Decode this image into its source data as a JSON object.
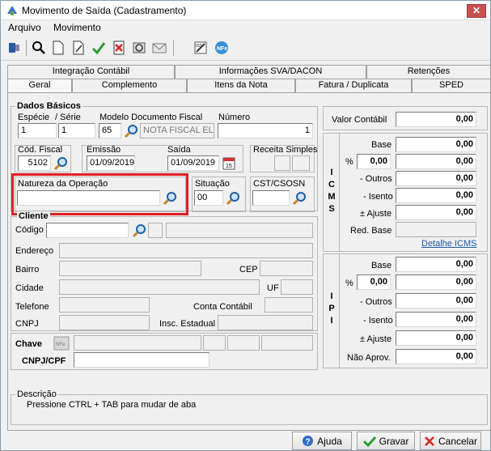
{
  "window": {
    "title": "Movimento de Saída (Cadastramento)",
    "close": "✕"
  },
  "menu": [
    "Arquivo",
    "Movimento"
  ],
  "tabs_top": [
    "Integração Contábil",
    "Informações SVA/DACON",
    "Retenções"
  ],
  "tabs_bottom": [
    "Geral",
    "Complemento",
    "Itens da Nota",
    "Fatura / Duplicata",
    "SPED"
  ],
  "dados": {
    "title": "Dados Básicos",
    "especie_label": "Espécie",
    "serie_label": "/  Série",
    "especie": "1",
    "serie": "1",
    "modelo_label": "Modelo Documento Fiscal",
    "modelo": "65",
    "modelo_desc": "NOTA FISCAL EL",
    "numero_label": "Número",
    "numero": "1",
    "cod_fiscal_label": "Cód. Fiscal",
    "cod_fiscal": "5102",
    "emissao_label": "Emissão",
    "emissao": "01/09/2019",
    "saida_label": "Saída",
    "saida": "01/09/2019",
    "receita_label": "Receita Simples",
    "natureza_label": "Natureza da Operação",
    "natureza": "",
    "situacao_label": "Situação",
    "situacao": "00",
    "cst_label": "CST/CSOSN",
    "cst": ""
  },
  "cliente": {
    "title": "Cliente",
    "codigo_label": "Código",
    "endereco_label": "Endereço",
    "bairro_label": "Bairro",
    "cep_label": "CEP",
    "cidade_label": "Cidade",
    "uf_label": "UF",
    "telefone_label": "Telefone",
    "conta_label": "Conta Contábil",
    "cnpj_label": "CNPJ",
    "insc_label": "Insc. Estadual"
  },
  "chave": {
    "label": "Chave",
    "cnpjcpf_label": "CNPJ/CPF"
  },
  "descricao": {
    "title": "Descrição",
    "text": "Pressione CTRL + TAB para  mudar de aba"
  },
  "valor": {
    "label": "Valor Contábil",
    "value": "0,00"
  },
  "icms": {
    "title": "I\nC\nM\nS",
    "base_label": "Base",
    "base": "0,00",
    "pct_label": "%",
    "pct": "0,00",
    "pct_value": "0,00",
    "outros_label": "- Outros",
    "outros": "0,00",
    "isento_label": "- Isento",
    "isento": "0,00",
    "ajuste_label": "± Ajuste",
    "ajuste": "0,00",
    "redbase_label": "Red. Base",
    "link": "Detalhe ICMS"
  },
  "ipi": {
    "title": "I\nP\nI",
    "base_label": "Base",
    "base": "0,00",
    "pct_label": "%",
    "pct": "0,00",
    "pct_value": "0,00",
    "outros_label": "- Outros",
    "outros": "0,00",
    "isento_label": "- Isento",
    "isento": "0,00",
    "ajuste_label": "± Ajuste",
    "ajuste": "0,00",
    "naoaprov_label": "Não Aprov.",
    "naoaprov": "0,00"
  },
  "buttons": {
    "ajuda": "Ajuda",
    "gravar": "Gravar",
    "cancelar": "Cancelar"
  },
  "colors": {
    "highlight": "#e01e24",
    "link": "#1f5aa6"
  }
}
